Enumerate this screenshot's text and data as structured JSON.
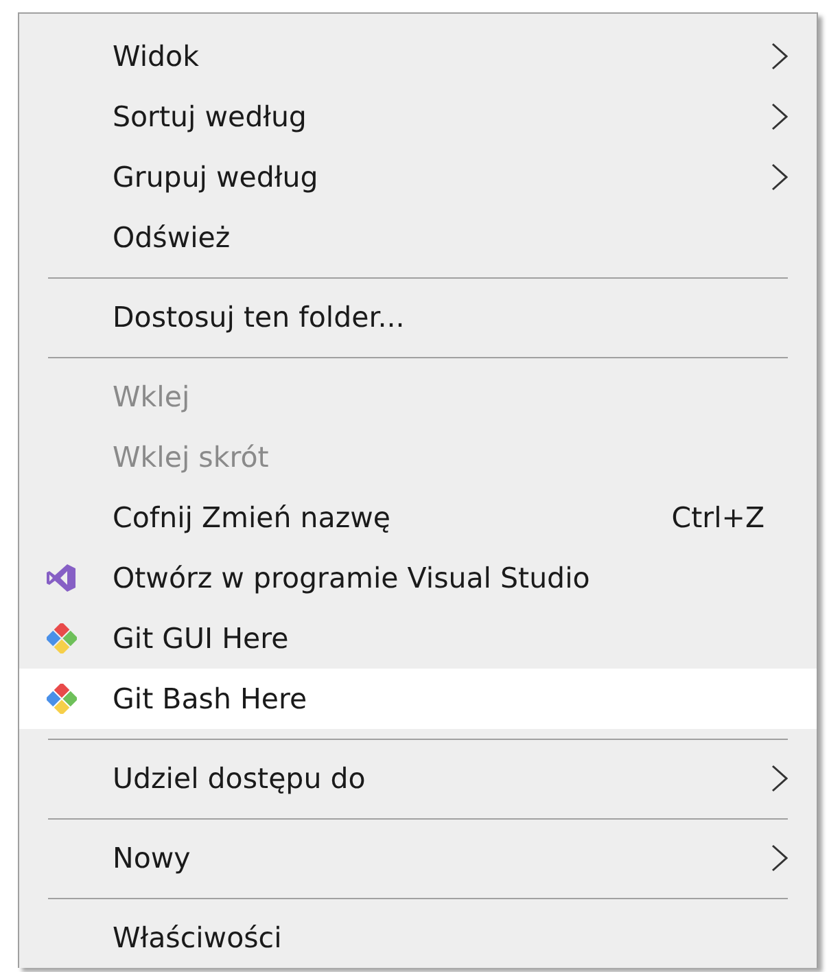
{
  "menu": {
    "items": [
      {
        "kind": "item",
        "label": "Widok",
        "submenu": true,
        "disabled": false,
        "selected": false
      },
      {
        "kind": "item",
        "label": "Sortuj według",
        "submenu": true,
        "disabled": false,
        "selected": false
      },
      {
        "kind": "item",
        "label": "Grupuj według",
        "submenu": true,
        "disabled": false,
        "selected": false
      },
      {
        "kind": "item",
        "label": "Odśwież",
        "submenu": false,
        "disabled": false,
        "selected": false
      },
      {
        "kind": "separator"
      },
      {
        "kind": "item",
        "label": "Dostosuj ten folder...",
        "submenu": false,
        "disabled": false,
        "selected": false
      },
      {
        "kind": "separator"
      },
      {
        "kind": "item",
        "label": "Wklej",
        "submenu": false,
        "disabled": true,
        "selected": false
      },
      {
        "kind": "item",
        "label": "Wklej skrót",
        "submenu": false,
        "disabled": true,
        "selected": false
      },
      {
        "kind": "item",
        "label": "Cofnij Zmień nazwę",
        "shortcut": "Ctrl+Z",
        "submenu": false,
        "disabled": false,
        "selected": false
      },
      {
        "kind": "vs-item",
        "label": "Otwórz w programie Visual Studio",
        "submenu": false,
        "disabled": false,
        "selected": false
      },
      {
        "kind": "git-item",
        "label": "Git GUI Here",
        "submenu": false,
        "disabled": false,
        "selected": false
      },
      {
        "kind": "git-item",
        "label": "Git Bash Here",
        "submenu": false,
        "disabled": false,
        "selected": true
      },
      {
        "kind": "separator"
      },
      {
        "kind": "item",
        "label": "Udziel dostępu do",
        "submenu": true,
        "disabled": false,
        "selected": false
      },
      {
        "kind": "separator"
      },
      {
        "kind": "item",
        "label": "Nowy",
        "submenu": true,
        "disabled": false,
        "selected": false
      },
      {
        "kind": "separator"
      },
      {
        "kind": "item",
        "label": "Właściwości",
        "submenu": false,
        "disabled": false,
        "selected": false
      }
    ]
  }
}
